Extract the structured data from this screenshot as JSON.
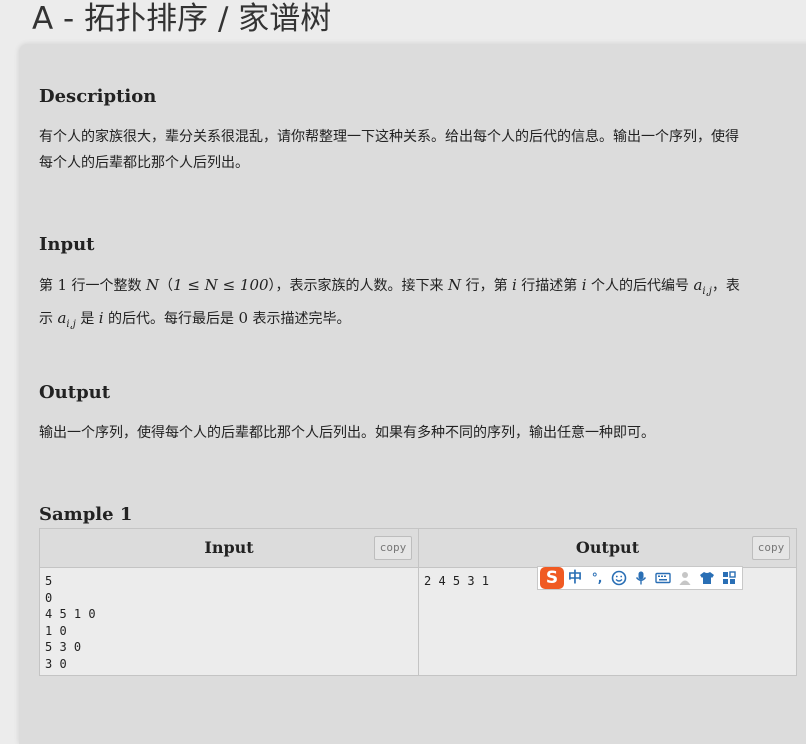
{
  "page": {
    "title": "A - 拓扑排序 / 家谱树"
  },
  "description": {
    "heading": "Description",
    "line1": "有个人的家族很大，辈分关系很混乱，请你帮整理一下这种关系。给出每个人的后代的信息。输出一个序列，使得",
    "line2": "每个人的后辈都比那个人后列出。"
  },
  "input": {
    "heading": "Input",
    "t1": "第 ",
    "n1": "1",
    "t2": " 行一个整数 ",
    "v_N": "N",
    "t3": "（",
    "range": "1 ≤ N ≤ 100",
    "t4": "），表示家族的人数。接下来 ",
    "v_N2": "N",
    "t5": " 行，第 ",
    "v_i": "i",
    "t6": " 行描述第 ",
    "v_i2": "i",
    "t7": " 个人的后代编号 ",
    "v_a": "a",
    "v_sub": "i,j",
    "t8": "，表",
    "t9": "示 ",
    "v_a2": "a",
    "v_sub2": "i,j",
    "t10": " 是 ",
    "v_i3": "i",
    "t11": " 的后代。每行最后是 ",
    "n0": "0",
    "t12": " 表示描述完毕。"
  },
  "output": {
    "heading": "Output",
    "text": "输出一个序列，使得每个人的后辈都比那个人后列出。如果有多种不同的序列，输出任意一种即可。"
  },
  "sample": {
    "heading": "Sample 1",
    "input_label": "Input",
    "output_label": "Output",
    "copy_label": "copy",
    "input_text": "5\n0\n4 5 1 0\n1 0\n5 3 0\n3 0",
    "output_text": "2 4 5 3 1"
  },
  "ime": {
    "logo": "S",
    "lang": "中",
    "punct": "°,",
    "icons": [
      "emoji-icon",
      "microphone-icon",
      "keyboard-icon",
      "user-icon",
      "skin-icon",
      "toolbox-icon"
    ],
    "accent": "#2a6fb5",
    "logo_color": "#f05a22"
  }
}
